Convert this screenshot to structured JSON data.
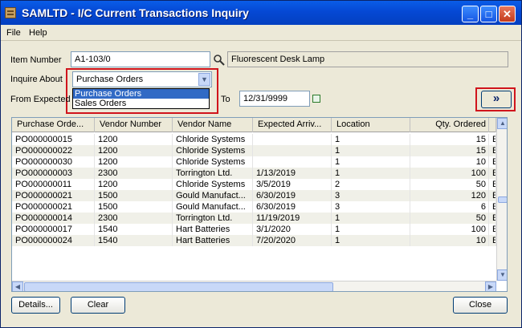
{
  "window": {
    "title": "SAMLTD - I/C Current Transactions Inquiry"
  },
  "menu": {
    "file": "File",
    "help": "Help"
  },
  "form": {
    "item_number_label": "Item Number",
    "item_number_value": "A1-103/0",
    "item_description": "Fluorescent Desk Lamp",
    "inquire_about_label": "Inquire About",
    "inquire_about_value": "Purchase Orders",
    "inquire_options": [
      "Purchase Orders",
      "Sales Orders"
    ],
    "from_label": "From Expected",
    "to_label": "To",
    "to_value": "12/31/9999",
    "next_button": "»"
  },
  "table": {
    "columns": [
      "Purchase Orde...",
      "Vendor Number",
      "Vendor Name",
      "Expected Arriv...",
      "Location",
      "Qty. Ordered",
      ""
    ],
    "rows": [
      [
        "PO000000015",
        "1200",
        "Chloride Systems",
        "",
        "1",
        "15",
        "E"
      ],
      [
        "PO000000022",
        "1200",
        "Chloride Systems",
        "",
        "1",
        "15",
        "E"
      ],
      [
        "PO000000030",
        "1200",
        "Chloride Systems",
        "",
        "1",
        "10",
        "E"
      ],
      [
        "PO000000003",
        "2300",
        "Torrington Ltd.",
        "1/13/2019",
        "1",
        "100",
        "E"
      ],
      [
        "PO000000011",
        "1200",
        "Chloride Systems",
        "3/5/2019",
        "2",
        "50",
        "E"
      ],
      [
        "PO000000021",
        "1500",
        "Gould Manufact...",
        "6/30/2019",
        "3",
        "120",
        "E"
      ],
      [
        "PO000000021",
        "1500",
        "Gould Manufact...",
        "6/30/2019",
        "3",
        "6",
        "E"
      ],
      [
        "PO000000014",
        "2300",
        "Torrington Ltd.",
        "11/19/2019",
        "1",
        "50",
        "E"
      ],
      [
        "PO000000017",
        "1540",
        "Hart Batteries",
        "3/1/2020",
        "1",
        "100",
        "E"
      ],
      [
        "PO000000024",
        "1540",
        "Hart Batteries",
        "7/20/2020",
        "1",
        "10",
        "E"
      ]
    ]
  },
  "buttons": {
    "details": "Details...",
    "clear": "Clear",
    "close": "Close"
  },
  "colors": {
    "highlight": "#316ac5",
    "annotation": "#d0141c",
    "titlebar": "#0548d4"
  }
}
